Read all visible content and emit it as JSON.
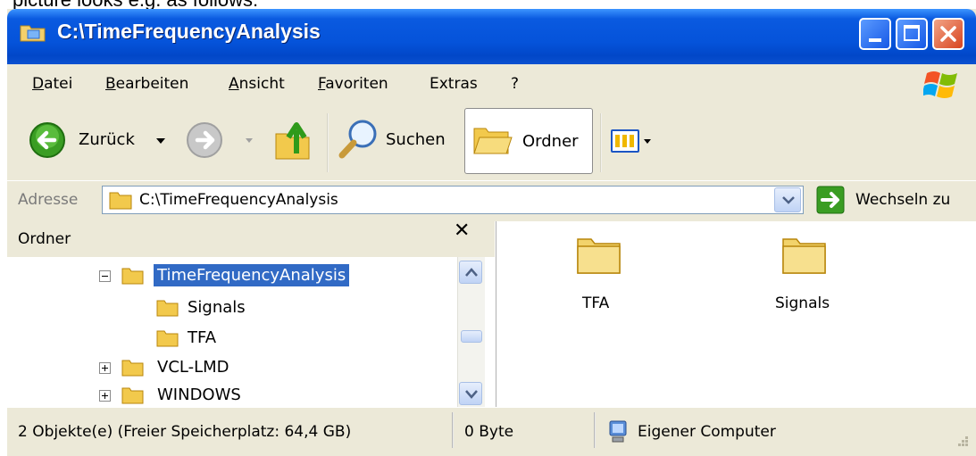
{
  "top_strip_text": "picture looks e.g. as follows:",
  "window": {
    "title": "C:\\TimeFrequencyAnalysis"
  },
  "menu": {
    "items": [
      "Datei",
      "Bearbeiten",
      "Ansicht",
      "Favoriten",
      "Extras",
      "?"
    ]
  },
  "toolbar": {
    "back_label": "Zurück",
    "search_label": "Suchen",
    "folders_label": "Ordner"
  },
  "address": {
    "label": "Adresse",
    "value": "C:\\TimeFrequencyAnalysis",
    "go_label": "Wechseln zu"
  },
  "folder_panel": {
    "title": "Ordner",
    "close_glyph": "✕",
    "tree": [
      {
        "label": "TimeFrequencyAnalysis",
        "expander": "−",
        "selected": true
      },
      {
        "label": "Signals"
      },
      {
        "label": "TFA"
      },
      {
        "label": "VCL-LMD",
        "expander": "+"
      },
      {
        "label": "WINDOWS",
        "expander": "+"
      }
    ]
  },
  "content": {
    "items": [
      {
        "label": "TFA",
        "icon": "folder-icon"
      },
      {
        "label": "Signals",
        "icon": "folder-icon"
      }
    ]
  },
  "status": {
    "objects": "2 Objekte(e) (Freier Speicherplatz: 64,4 GB)",
    "size": "0 Byte",
    "location": "Eigener Computer"
  },
  "colors": {
    "title_bar": "#0553da",
    "selection": "#316ac5",
    "chrome": "#ece9d8"
  }
}
